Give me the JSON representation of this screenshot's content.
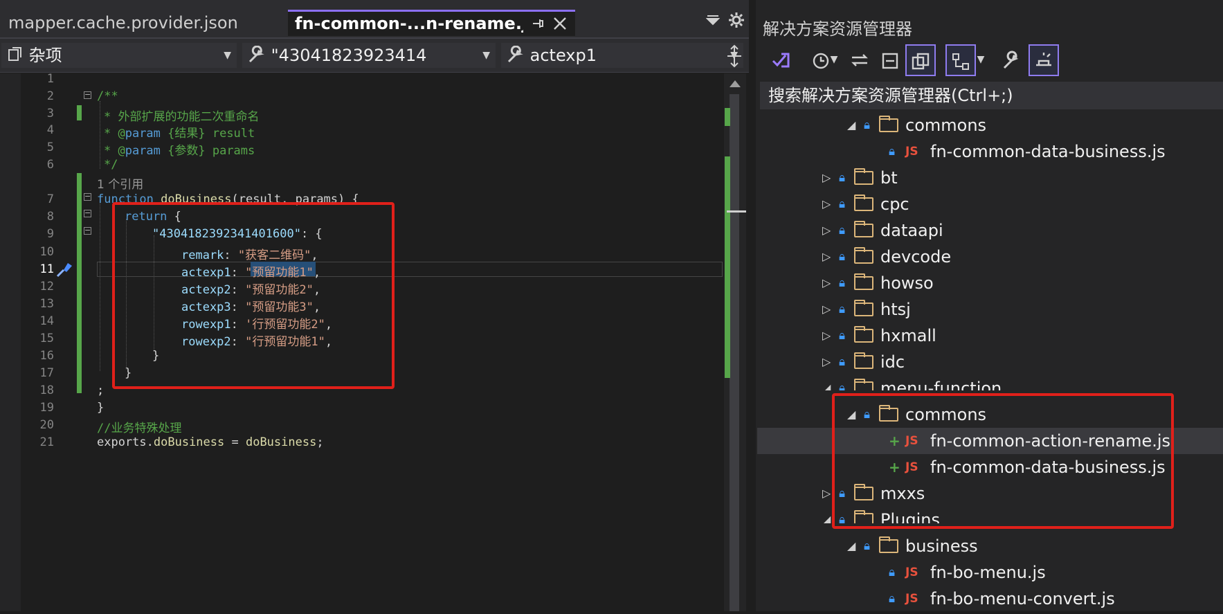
{
  "editor": {
    "tabs": [
      {
        "label": "mapper.cache.provider.json"
      },
      {
        "label": "fn-common-...n-rename.js",
        "pin_icon": "pin-icon",
        "close_icon": "close-icon"
      }
    ],
    "nav": {
      "project": "杂项",
      "scope": "\"43041823923414",
      "member": "actexp1"
    },
    "line_numbers": [
      "1",
      "2",
      "3",
      "4",
      "5",
      "6",
      "7",
      "8",
      "9",
      "10",
      "11",
      "12",
      "13",
      "14",
      "15",
      "16",
      "17",
      "18",
      "19",
      "20",
      "21"
    ],
    "ref_count": "1 个引用",
    "code": {
      "l2": "/**",
      "l3": "* 外部扩展的功能二次重命名",
      "l4_tag": "* @",
      "l4_param": "param",
      "l4_rest": " {结果} result",
      "l5_tag": "* @",
      "l5_param": "param",
      "l5_rest": " {参数} params",
      "l6": "*/",
      "l7_kw": "function",
      "l7_name": "doBusiness",
      "l7_rest": "(result, params) {",
      "l8_kw": "return",
      "l8_rest": " {",
      "l9_key": "\"4304182392341401600\"",
      "l9_rest": ": {",
      "l10_key": "remark",
      "l10_val": "\"获客二维码\"",
      "l11_key": "actexp1",
      "l11_q1": "\"",
      "l11_word": "预留功能1",
      "l11_q2": "\"",
      "l12_key": "actexp2",
      "l12_val": "\"预留功能2\"",
      "l13_key": "actexp3",
      "l13_val": "\"预留功能3\"",
      "l14_key": "rowexp1",
      "l14_val": "'行预留功能2\"",
      "l15_key": "rowexp2",
      "l15_val": "\"行预留功能1\"",
      "l16": "}",
      "l17": "}",
      "l18": ";",
      "l19": "}",
      "l20": "//业务特殊处理",
      "l21_a": "exports.",
      "l21_b": "doBusiness",
      "l21_c": " = ",
      "l21_d": "doBusiness",
      "l21_e": ";",
      "sep": ": ",
      "comma": ","
    }
  },
  "solution_explorer": {
    "title": "解决方案资源管理器",
    "search_placeholder": "搜索解决方案资源管理器(Ctrl+;)",
    "toolbar_icons": [
      "vs-icon",
      "history-icon",
      "sync-icon",
      "collapse-all-icon",
      "show-all-files-icon",
      "dependency-icon",
      "properties-icon",
      "preview-icon"
    ],
    "tree": [
      {
        "label": "commons",
        "type": "folder",
        "expanded": true
      },
      {
        "label": "fn-common-data-business.js",
        "type": "js",
        "state": "locked"
      },
      {
        "label": "bt",
        "type": "folder",
        "expanded": false
      },
      {
        "label": "cpc",
        "type": "folder",
        "expanded": false
      },
      {
        "label": "dataapi",
        "type": "folder",
        "expanded": false
      },
      {
        "label": "devcode",
        "type": "folder",
        "expanded": false
      },
      {
        "label": "howso",
        "type": "folder",
        "expanded": false
      },
      {
        "label": "htsj",
        "type": "folder",
        "expanded": false
      },
      {
        "label": "hxmall",
        "type": "folder",
        "expanded": false
      },
      {
        "label": "idc",
        "type": "folder",
        "expanded": false
      },
      {
        "label": "menu-function",
        "type": "folder",
        "expanded": true
      },
      {
        "label": "commons",
        "type": "folder",
        "expanded": true
      },
      {
        "label": "fn-common-action-rename.js",
        "type": "js",
        "state": "added",
        "selected": true
      },
      {
        "label": "fn-common-data-business.js",
        "type": "js",
        "state": "added"
      },
      {
        "label": "mxxs",
        "type": "folder",
        "expanded": false
      },
      {
        "label": "Plugins",
        "type": "folder",
        "expanded": true
      },
      {
        "label": "business",
        "type": "folder",
        "expanded": true
      },
      {
        "label": "fn-bo-menu.js",
        "type": "js",
        "state": "locked"
      },
      {
        "label": "fn-bo-menu-convert.js",
        "type": "js",
        "state": "locked"
      }
    ]
  },
  "colors": {
    "accent": "#8b6ff0",
    "annotation": "#e0201a",
    "change_bar": "#57a64a",
    "lock": "#3f9bff",
    "js": "#e8513d"
  }
}
